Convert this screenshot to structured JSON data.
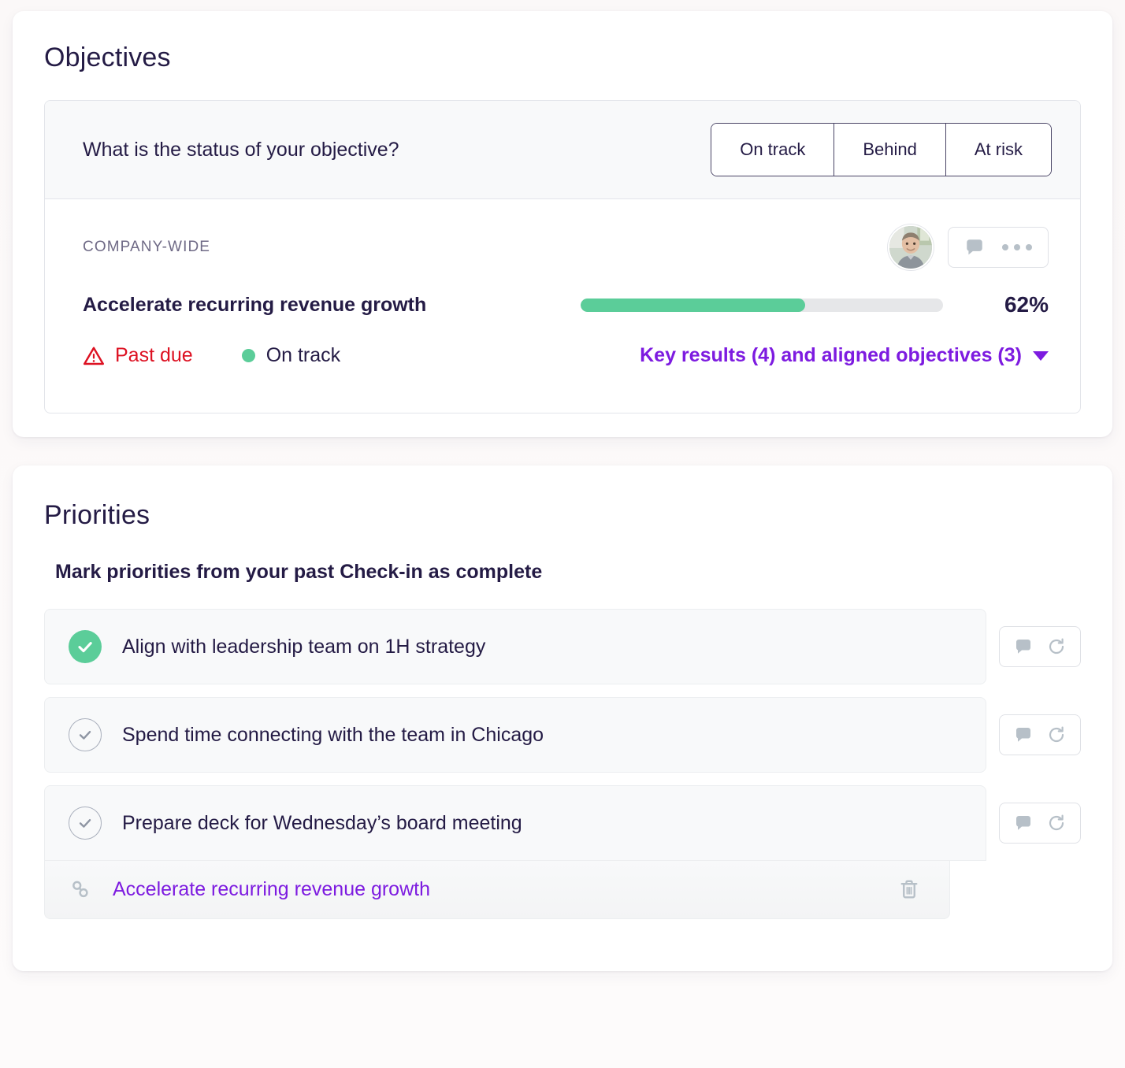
{
  "objectives": {
    "title": "Objectives",
    "question": "What is the status of your objective?",
    "status_options": [
      {
        "label": "On track"
      },
      {
        "label": "Behind"
      },
      {
        "label": "At risk"
      }
    ],
    "item": {
      "scope_tag": "COMPANY-WIDE",
      "name": "Accelerate recurring revenue growth",
      "progress_percent": 62,
      "progress_label": "62%",
      "due_status": "Past due",
      "track_status": "On track",
      "key_results_link": "Key results (4) and aligned objectives (3)",
      "comment_icon": "comment-icon",
      "more_icon": "more-options-icon",
      "warning_icon": "warning-triangle-icon",
      "caret_icon": "chevron-down-icon",
      "avatar_icon": "user-avatar-photo"
    },
    "colors": {
      "progress_fill": "#5bcd99",
      "progress_track": "#e6e7e9",
      "past_due": "#dd1122",
      "link": "#7d1be0",
      "text": "#241b45"
    }
  },
  "priorities": {
    "title": "Priorities",
    "subheading": "Mark priorities from your past Check-in as complete",
    "items": [
      {
        "label": "Align with leadership team on 1H strategy",
        "completed": true,
        "comment_icon": "comment-icon",
        "repeat_icon": "repeat-icon"
      },
      {
        "label": "Spend time connecting with the team in Chicago",
        "completed": false,
        "comment_icon": "comment-icon",
        "repeat_icon": "repeat-icon"
      },
      {
        "label": "Prepare deck for Wednesday’s board meeting",
        "completed": false,
        "comment_icon": "comment-icon",
        "repeat_icon": "repeat-icon"
      }
    ],
    "linked_objective": {
      "label": "Accelerate recurring revenue growth",
      "link_icon": "chain-link-icon",
      "delete_icon": "trash-icon"
    }
  }
}
